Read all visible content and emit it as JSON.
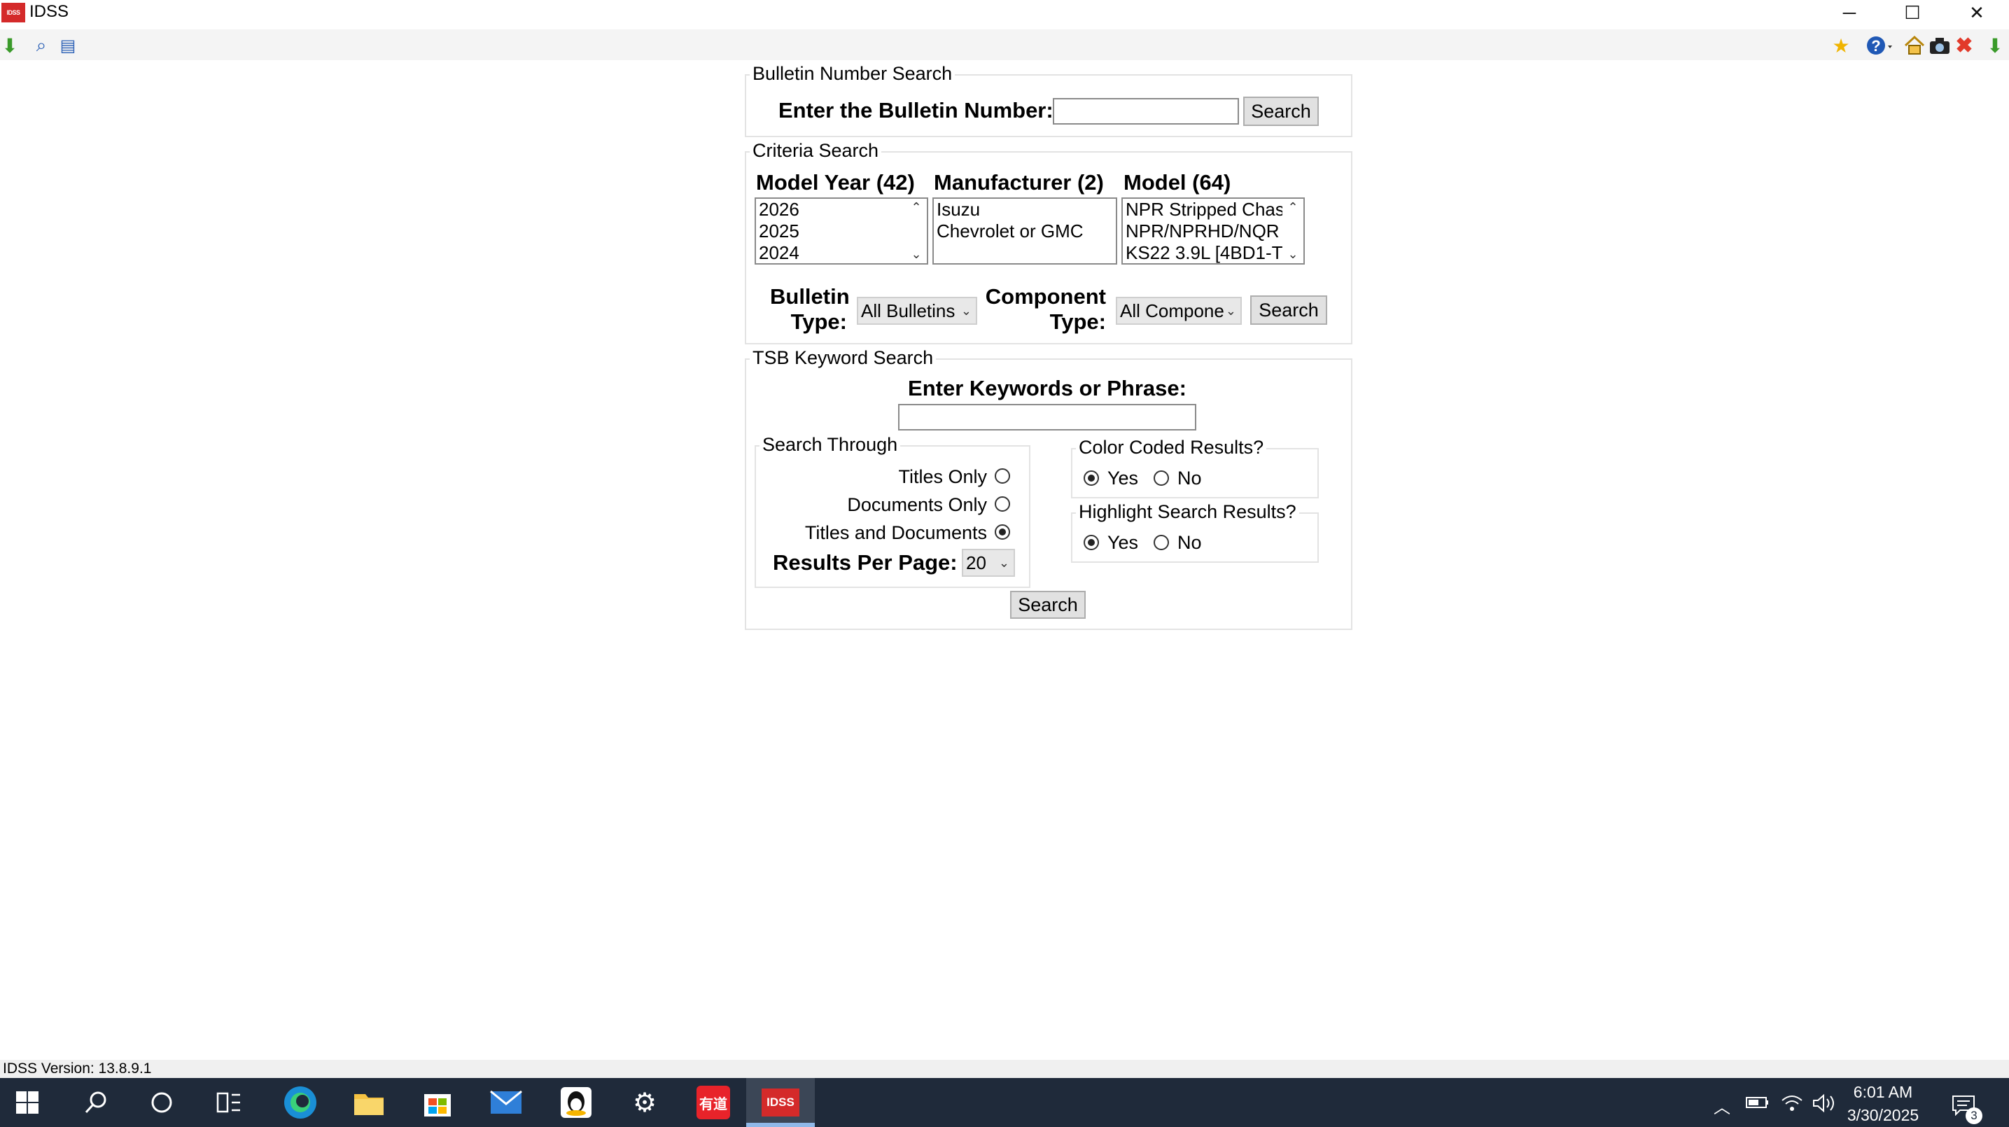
{
  "window": {
    "app_icon_text": "IDSS",
    "title": "IDSS",
    "minimize_glyph": "─",
    "maximize_glyph": "☐",
    "close_glyph": "✕"
  },
  "toolbar": {
    "left_icons": [
      "download-icon",
      "search-icon",
      "print-icon"
    ],
    "right_icons": [
      "favorites-icon",
      "help-icon",
      "home-icon",
      "camera-icon",
      "close-red-icon",
      "download-icon"
    ]
  },
  "bulletin_search": {
    "legend": "Bulletin Number Search",
    "label": "Enter the Bulletin Number:",
    "value": "",
    "button": "Search"
  },
  "criteria_search": {
    "legend": "Criteria Search",
    "model_year": {
      "label": "Model Year (42)",
      "items": [
        "2026",
        "2025",
        "2024"
      ]
    },
    "manufacturer": {
      "label": "Manufacturer (2)",
      "items": [
        "Isuzu",
        "Chevrolet or GMC"
      ]
    },
    "model": {
      "label": "Model (64)",
      "items": [
        "NPR Stripped Chas",
        "NPR/NPRHD/NQR",
        "KS22 3.9L [4BD1-T"
      ]
    },
    "bulletin_type": {
      "label_1": "Bulletin",
      "label_2": "Type:",
      "selected": "All Bulletins"
    },
    "component_type": {
      "label_1": "Component",
      "label_2": "Type:",
      "selected": "All Compone"
    },
    "button": "Search"
  },
  "keyword_search": {
    "legend": "TSB Keyword Search",
    "label": "Enter Keywords or Phrase:",
    "value": "",
    "search_through": {
      "legend": "Search Through",
      "options": [
        {
          "label": "Titles Only",
          "selected": false
        },
        {
          "label": "Documents Only",
          "selected": false
        },
        {
          "label": "Titles and Documents",
          "selected": true
        }
      ],
      "results_label": "Results Per Page:",
      "results_value": "20"
    },
    "color_coded": {
      "legend": "Color Coded Results?",
      "yes": "Yes",
      "no": "No",
      "selected": "Yes"
    },
    "highlight": {
      "legend": "Highlight Search Results?",
      "yes": "Yes",
      "no": "No",
      "selected": "Yes"
    },
    "button": "Search"
  },
  "status": {
    "version": "IDSS Version: 13.8.9.1"
  },
  "taskbar": {
    "time": "6:01 AM",
    "date": "3/30/2025",
    "notification_count": "3",
    "youdao_label": "有道",
    "idss_label": "IDSS"
  },
  "colors": {
    "accent_red": "#d42a2a",
    "taskbar": "#1f2a3a",
    "edge_blue": "#1a8fd6"
  }
}
